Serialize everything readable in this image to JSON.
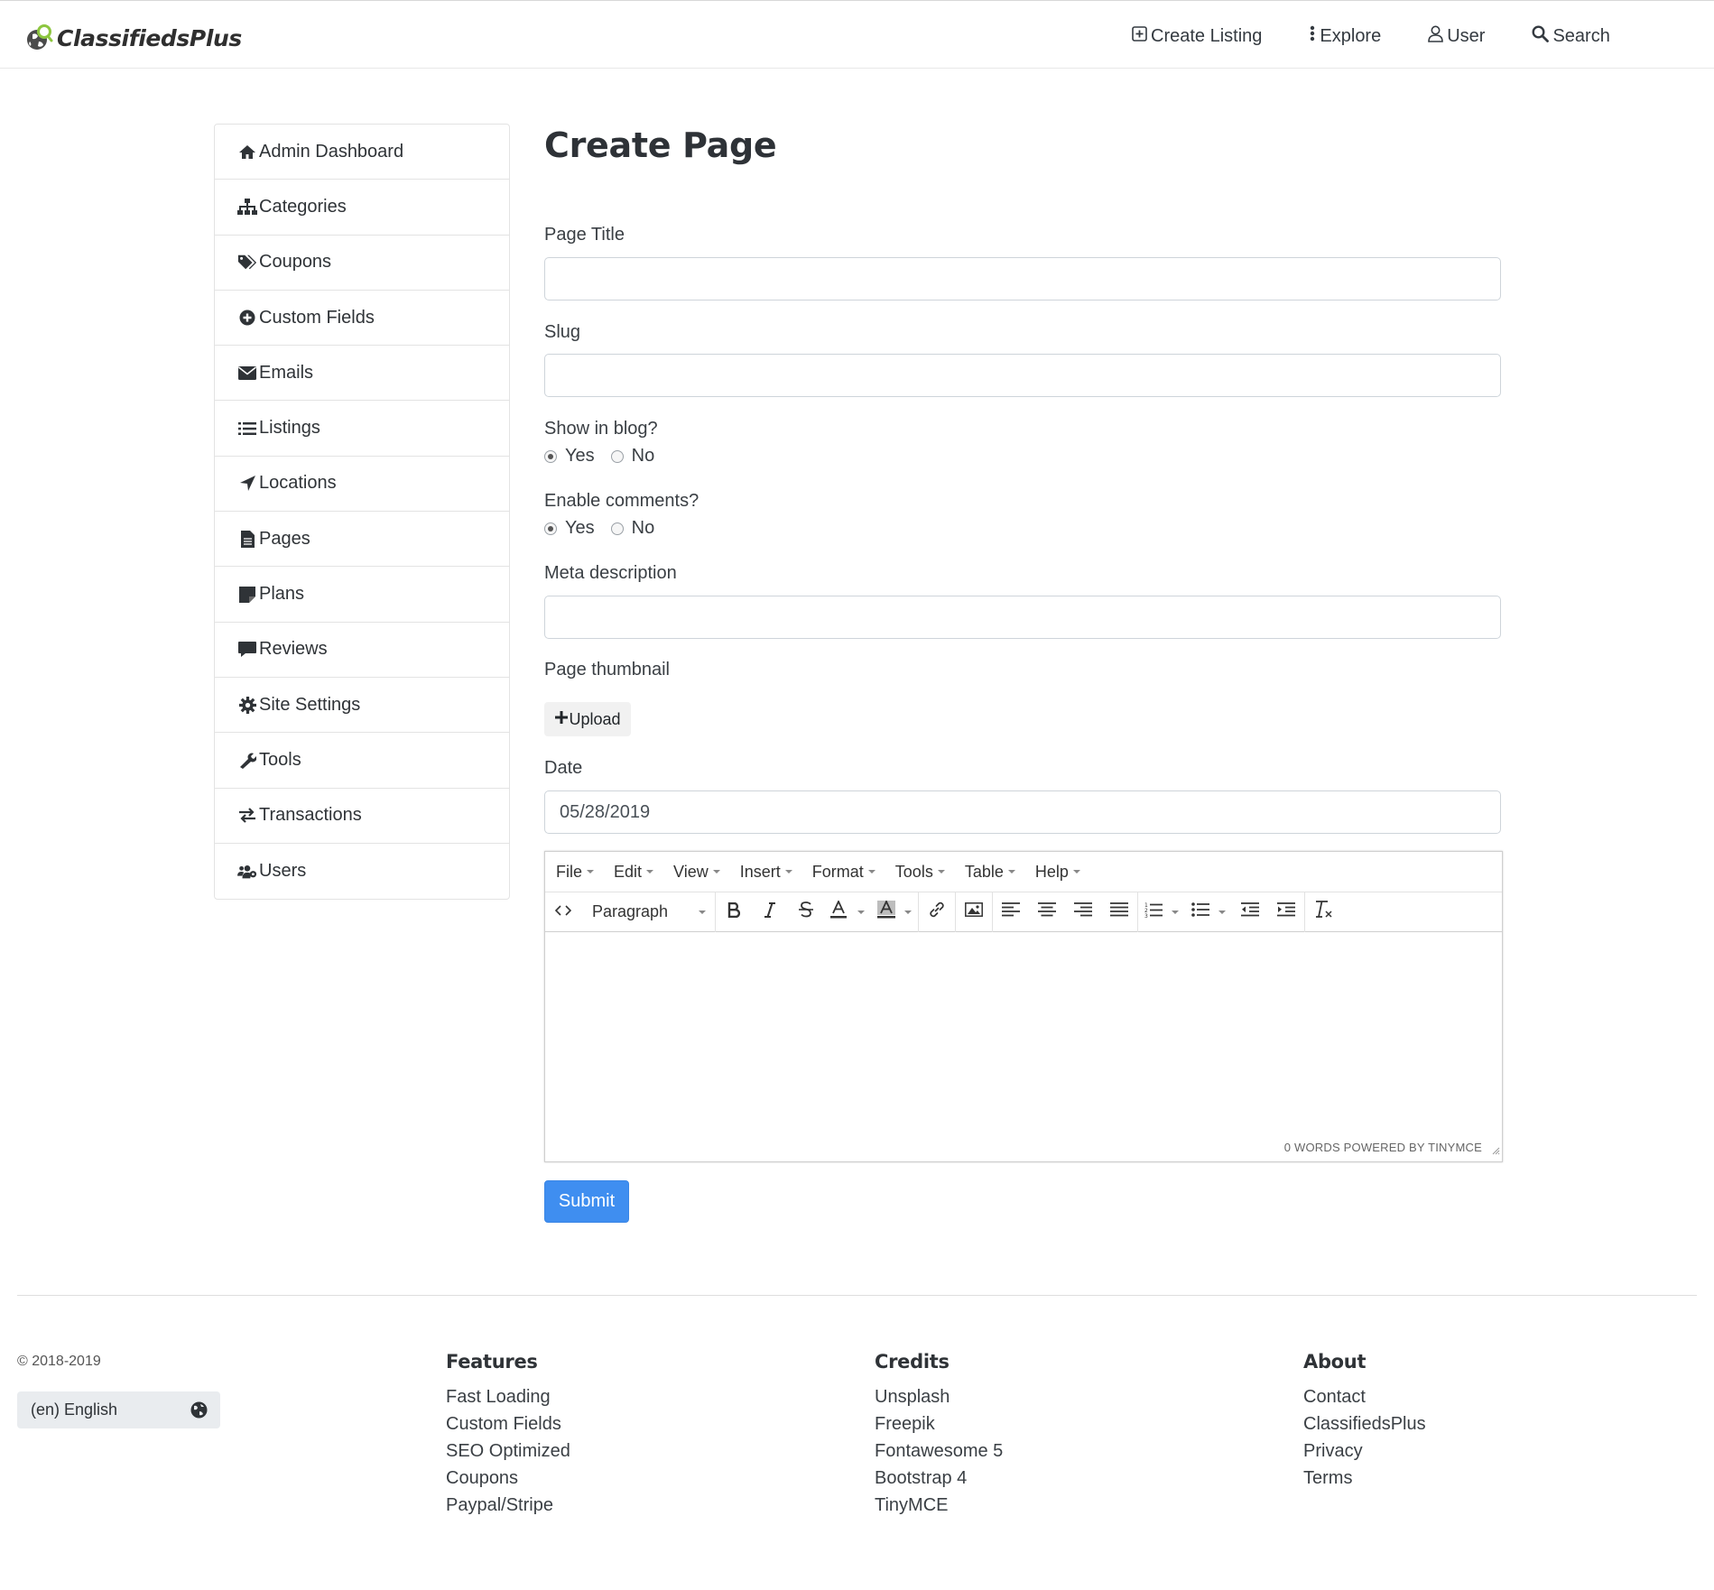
{
  "header": {
    "brand": "ClassifiedsPlus",
    "nav": [
      {
        "label": "Create Listing",
        "icon": "plus-square-icon"
      },
      {
        "label": "Explore",
        "icon": "ellipsis-vertical-icon"
      },
      {
        "label": "User",
        "icon": "user-icon"
      },
      {
        "label": "Search",
        "icon": "search-icon"
      }
    ]
  },
  "sidebar": {
    "items": [
      {
        "label": "Admin Dashboard",
        "icon": "home-icon"
      },
      {
        "label": "Categories",
        "icon": "sitemap-icon"
      },
      {
        "label": "Coupons",
        "icon": "tags-icon"
      },
      {
        "label": "Custom Fields",
        "icon": "plus-circle-icon"
      },
      {
        "label": "Emails",
        "icon": "envelope-icon"
      },
      {
        "label": "Listings",
        "icon": "list-icon"
      },
      {
        "label": "Locations",
        "icon": "location-arrow-icon"
      },
      {
        "label": "Pages",
        "icon": "file-icon"
      },
      {
        "label": "Plans",
        "icon": "sticky-note-icon"
      },
      {
        "label": "Reviews",
        "icon": "comment-icon"
      },
      {
        "label": "Site Settings",
        "icon": "gear-icon"
      },
      {
        "label": "Tools",
        "icon": "wrench-icon"
      },
      {
        "label": "Transactions",
        "icon": "exchange-icon"
      },
      {
        "label": "Users",
        "icon": "users-cog-icon"
      }
    ]
  },
  "form": {
    "heading": "Create Page",
    "page_title_label": "Page Title",
    "page_title_value": "",
    "slug_label": "Slug",
    "slug_value": "",
    "show_in_blog_label": "Show in blog?",
    "show_in_blog_options": [
      "Yes",
      "No"
    ],
    "show_in_blog_selected": "Yes",
    "enable_comments_label": "Enable comments?",
    "enable_comments_options": [
      "Yes",
      "No"
    ],
    "enable_comments_selected": "Yes",
    "meta_description_label": "Meta description",
    "meta_description_value": "",
    "thumbnail_label": "Page thumbnail",
    "upload_label": "Upload",
    "date_label": "Date",
    "date_value": "05/28/2019",
    "submit_label": "Submit"
  },
  "editor": {
    "menus": [
      "File",
      "Edit",
      "View",
      "Insert",
      "Format",
      "Tools",
      "Table",
      "Help"
    ],
    "block_format": "Paragraph",
    "status": "0 WORDS POWERED BY TINYMCE"
  },
  "footer": {
    "copyright": "© 2018-2019",
    "language": "(en) English",
    "columns": [
      {
        "title": "Features",
        "links": [
          "Fast Loading",
          "Custom Fields",
          "SEO Optimized",
          "Coupons",
          "Paypal/Stripe"
        ]
      },
      {
        "title": "Credits",
        "links": [
          "Unsplash",
          "Freepik",
          "Fontawesome 5",
          "Bootstrap 4",
          "TinyMCE"
        ]
      },
      {
        "title": "About",
        "links": [
          "Contact",
          "ClassifiedsPlus",
          "Privacy",
          "Terms"
        ]
      }
    ]
  },
  "colors": {
    "primary": "#3f8ef0",
    "logo_green": "#8dc63f",
    "text_dark": "#2f3337"
  }
}
